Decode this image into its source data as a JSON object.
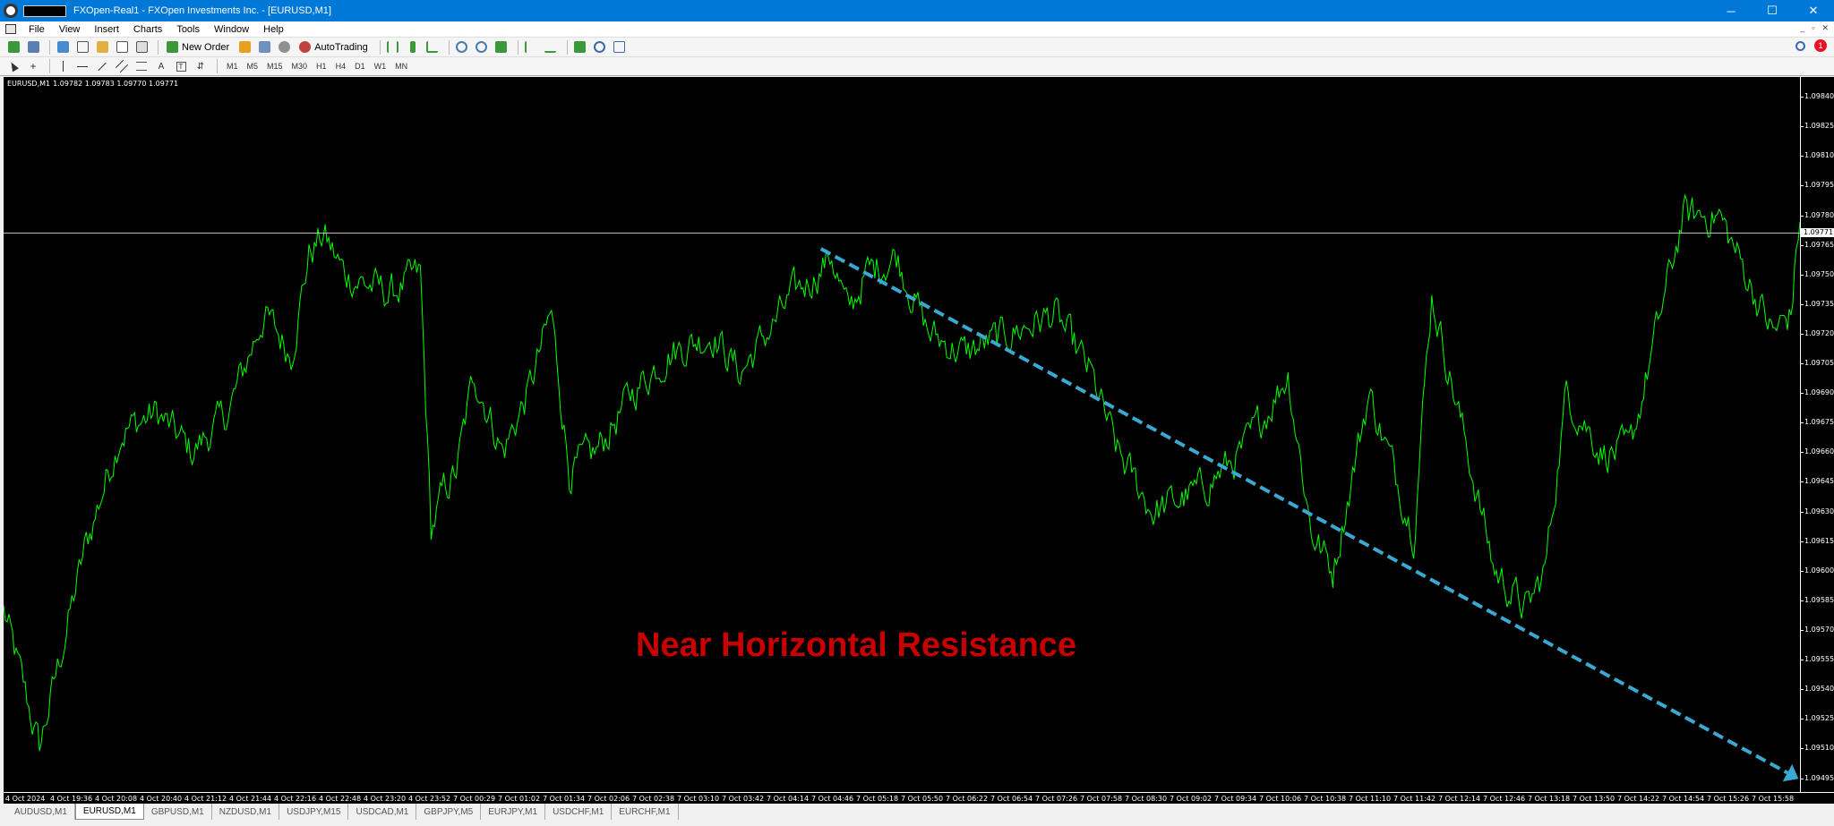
{
  "window": {
    "title": "FXOpen-Real1 - FXOpen Investments Inc. - [EURUSD,M1]",
    "min_glyph": "─",
    "max_glyph": "☐",
    "close_glyph": "✕"
  },
  "menu": {
    "items": [
      "File",
      "View",
      "Insert",
      "Charts",
      "Tools",
      "Window",
      "Help"
    ],
    "mdi_min": "_",
    "mdi_restore": "▫",
    "mdi_close": "✕"
  },
  "toolbar": {
    "new_order_label": "New Order",
    "autotrading_label": "AutoTrading",
    "notification_count": "1"
  },
  "timeframes": [
    "M1",
    "M5",
    "M15",
    "M30",
    "H1",
    "H4",
    "D1",
    "W1",
    "MN"
  ],
  "chart": {
    "symbol_label": "EURUSD,M1",
    "ohlc": "1.09782 1.09783 1.09770 1.09771",
    "current_price": "1.09771",
    "annotation": "Near Horizontal Resistance",
    "line_color": "#00ff00",
    "trendline_color": "#3aa8d0",
    "annotation_color": "#c80000",
    "price_labels": [
      "1.09840",
      "1.09825",
      "1.09810",
      "1.09795",
      "1.09780",
      "1.09765",
      "1.09750",
      "1.09735",
      "1.09720",
      "1.09705",
      "1.09690",
      "1.09675",
      "1.09660",
      "1.09645",
      "1.09630",
      "1.09615",
      "1.09600",
      "1.09585",
      "1.09570",
      "1.09555",
      "1.09540",
      "1.09525",
      "1.09510",
      "1.09495"
    ],
    "time_labels": [
      "4 Oct 2024",
      "4 Oct 19:36",
      "4 Oct 20:08",
      "4 Oct 20:40",
      "4 Oct 21:12",
      "4 Oct 21:44",
      "4 Oct 22:16",
      "4 Oct 22:48",
      "4 Oct 23:20",
      "4 Oct 23:52",
      "7 Oct 00:29",
      "7 Oct 01:02",
      "7 Oct 01:34",
      "7 Oct 02:06",
      "7 Oct 02:38",
      "7 Oct 03:10",
      "7 Oct 03:42",
      "7 Oct 04:14",
      "7 Oct 04:46",
      "7 Oct 05:18",
      "7 Oct 05:50",
      "7 Oct 06:22",
      "7 Oct 06:54",
      "7 Oct 07:26",
      "7 Oct 07:58",
      "7 Oct 08:30",
      "7 Oct 09:02",
      "7 Oct 09:34",
      "7 Oct 10:06",
      "7 Oct 10:38",
      "7 Oct 11:10",
      "7 Oct 11:42",
      "7 Oct 12:14",
      "7 Oct 12:46",
      "7 Oct 13:18",
      "7 Oct 13:50",
      "7 Oct 14:22",
      "7 Oct 14:54",
      "7 Oct 15:26",
      "7 Oct 15:58"
    ]
  },
  "chart_data": {
    "type": "line",
    "ylim": [
      1.09488,
      1.0985
    ],
    "x_index_range": [
      0,
      1000
    ],
    "series": [
      {
        "anchors": [
          [
            0,
            1.0958
          ],
          [
            20,
            1.0951
          ],
          [
            45,
            1.0961
          ],
          [
            65,
            1.0967
          ],
          [
            85,
            1.0968
          ],
          [
            105,
            1.0966
          ],
          [
            125,
            1.0968
          ],
          [
            145,
            1.0973
          ],
          [
            160,
            1.0971
          ],
          [
            170,
            1.0976
          ],
          [
            178,
            1.0977
          ],
          [
            190,
            1.0975
          ],
          [
            215,
            1.0974
          ],
          [
            232,
            1.0975
          ],
          [
            238,
            1.0962
          ],
          [
            245,
            1.0964
          ],
          [
            252,
            1.0965
          ],
          [
            262,
            1.097
          ],
          [
            278,
            1.0966
          ],
          [
            292,
            1.0969
          ],
          [
            305,
            1.0973
          ],
          [
            315,
            1.0965
          ],
          [
            330,
            1.0966
          ],
          [
            350,
            1.0969
          ],
          [
            370,
            1.0971
          ],
          [
            395,
            1.0972
          ],
          [
            410,
            1.097
          ],
          [
            425,
            1.0972
          ],
          [
            440,
            1.0974
          ],
          [
            452,
            1.0975
          ],
          [
            461,
            1.0976
          ],
          [
            470,
            1.0973
          ],
          [
            480,
            1.0975
          ],
          [
            497,
            1.0976
          ],
          [
            515,
            1.0972
          ],
          [
            535,
            1.0971
          ],
          [
            560,
            1.0972
          ],
          [
            585,
            1.0973
          ],
          [
            605,
            1.097
          ],
          [
            620,
            1.0966
          ],
          [
            640,
            1.0963
          ],
          [
            665,
            1.0964
          ],
          [
            690,
            1.0966
          ],
          [
            715,
            1.097
          ],
          [
            728,
            1.0962
          ],
          [
            740,
            1.096
          ],
          [
            760,
            1.0969
          ],
          [
            785,
            1.0962
          ],
          [
            795,
            1.0974
          ],
          [
            805,
            1.097
          ],
          [
            815,
            1.0966
          ],
          [
            830,
            1.096
          ],
          [
            848,
            1.0958
          ],
          [
            858,
            1.096
          ],
          [
            870,
            1.0969
          ],
          [
            890,
            1.0966
          ],
          [
            905,
            1.0966
          ],
          [
            915,
            1.097
          ],
          [
            935,
            1.0978
          ],
          [
            955,
            1.0978
          ],
          [
            965,
            1.0976
          ],
          [
            985,
            1.0972
          ],
          [
            995,
            1.0973
          ],
          [
            1000,
            1.0978
          ]
        ]
      }
    ],
    "resistance_price": 1.09771,
    "trendline": {
      "x": [
        455,
        1000
      ],
      "y": [
        1.09763,
        1.09495
      ]
    }
  },
  "tabs": [
    "AUDUSD,M1",
    "EURUSD,M1",
    "GBPUSD,M1",
    "NZDUSD,M1",
    "USDJPY,M15",
    "USDCAD,M1",
    "GBPJPY,M5",
    "EURJPY,M1",
    "USDCHF,M1",
    "EURCHF,M1"
  ],
  "active_tab": 1
}
